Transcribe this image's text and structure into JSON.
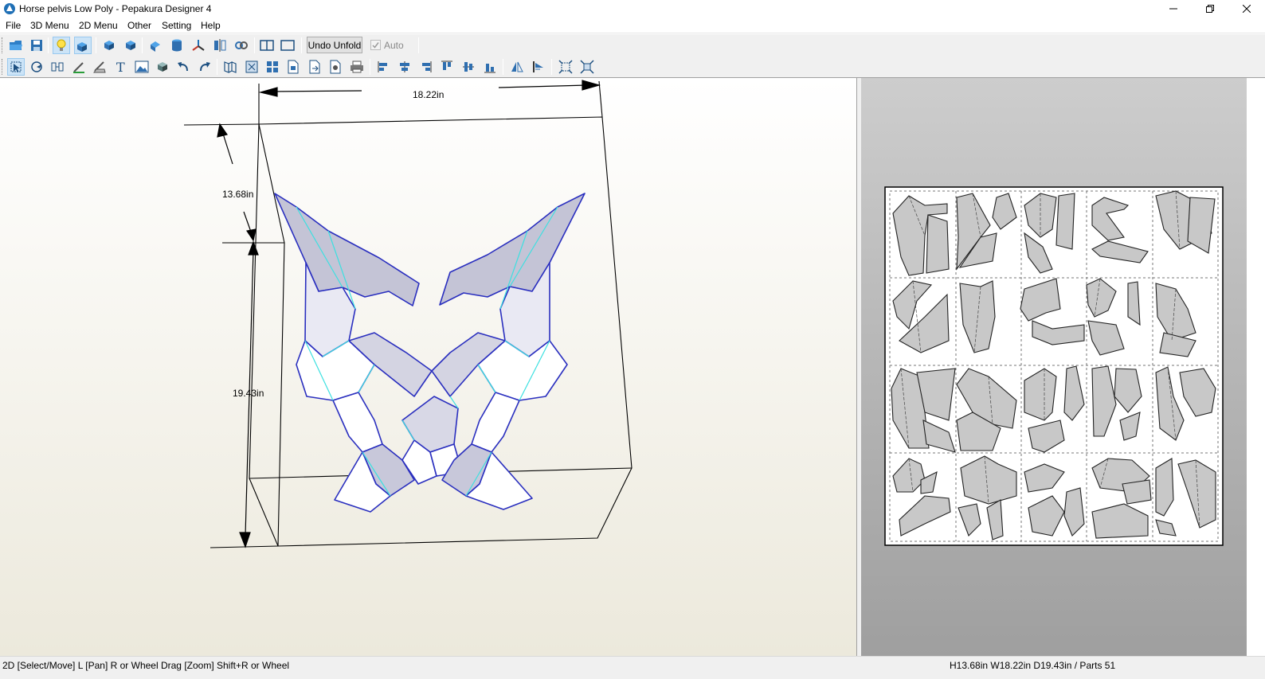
{
  "window": {
    "title": "Horse pelvis Low Poly - Pepakura Designer 4"
  },
  "menu": [
    "File",
    "3D Menu",
    "2D Menu",
    "Other",
    "Setting",
    "Help"
  ],
  "toolbar": {
    "undo_unfold_label": "Undo Unfold",
    "auto_label": "Auto"
  },
  "dimensions": {
    "width_label": "18.22in",
    "height_label": "13.68in",
    "depth_label": "19.43in"
  },
  "status": {
    "left": "2D [Select/Move] L [Pan] R or Wheel Drag [Zoom] Shift+R or Wheel",
    "right": "H13.68in W18.22in D19.43in / Parts 51"
  },
  "colors": {
    "edge_blue": "#2a2fbf",
    "fold_cyan": "#3ce0e0",
    "part_gray": "#c8c8c8"
  }
}
